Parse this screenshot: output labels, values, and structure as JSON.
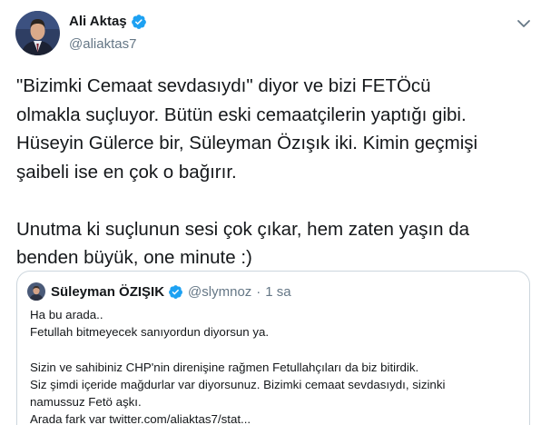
{
  "author": {
    "display_name": "Ali Aktaş",
    "handle": "@aliaktas7",
    "verified_icon": "verified-badge-icon",
    "more_icon": "chevron-down-icon"
  },
  "tweet": {
    "text": "\"Bizimki Cemaat sevdasıydı\" diyor ve bizi FETÖcü\nolmakla suçluyor. Bütün eski cemaatçilerin yaptığı gibi.\nHüseyin Gülerce bir, Süleyman Özışık iki. Kimin geçmişi\nşaibeli ise en çok o bağırır.\n\nUnutma ki suçlunun sesi çok çıkar, hem zaten yaşın da\nbenden büyük, one minute :)"
  },
  "quoted_tweet": {
    "display_name": "Süleyman ÖZIŞIK",
    "handle": "@slymnoz",
    "separator": "·",
    "time": "1 sa",
    "text": "Ha bu arada..\nFetullah bitmeyecek sanıyordun diyorsun ya.\n\nSizin ve sahibiniz CHP'nin direnişine rağmen Fetullahçıları da biz bitirdik.\nSiz şimdi içeride mağdurlar var diyorsunuz. Bizimki cemaat sevdasıydı, sizinki\nnamussuz Fetö aşkı.\nArada fark var twitter.com/aliaktas7/stat..."
  },
  "colors": {
    "text_primary": "#14171a",
    "text_secondary": "#657786",
    "verified_blue": "#1da1f2",
    "border": "#ccd6dd"
  }
}
